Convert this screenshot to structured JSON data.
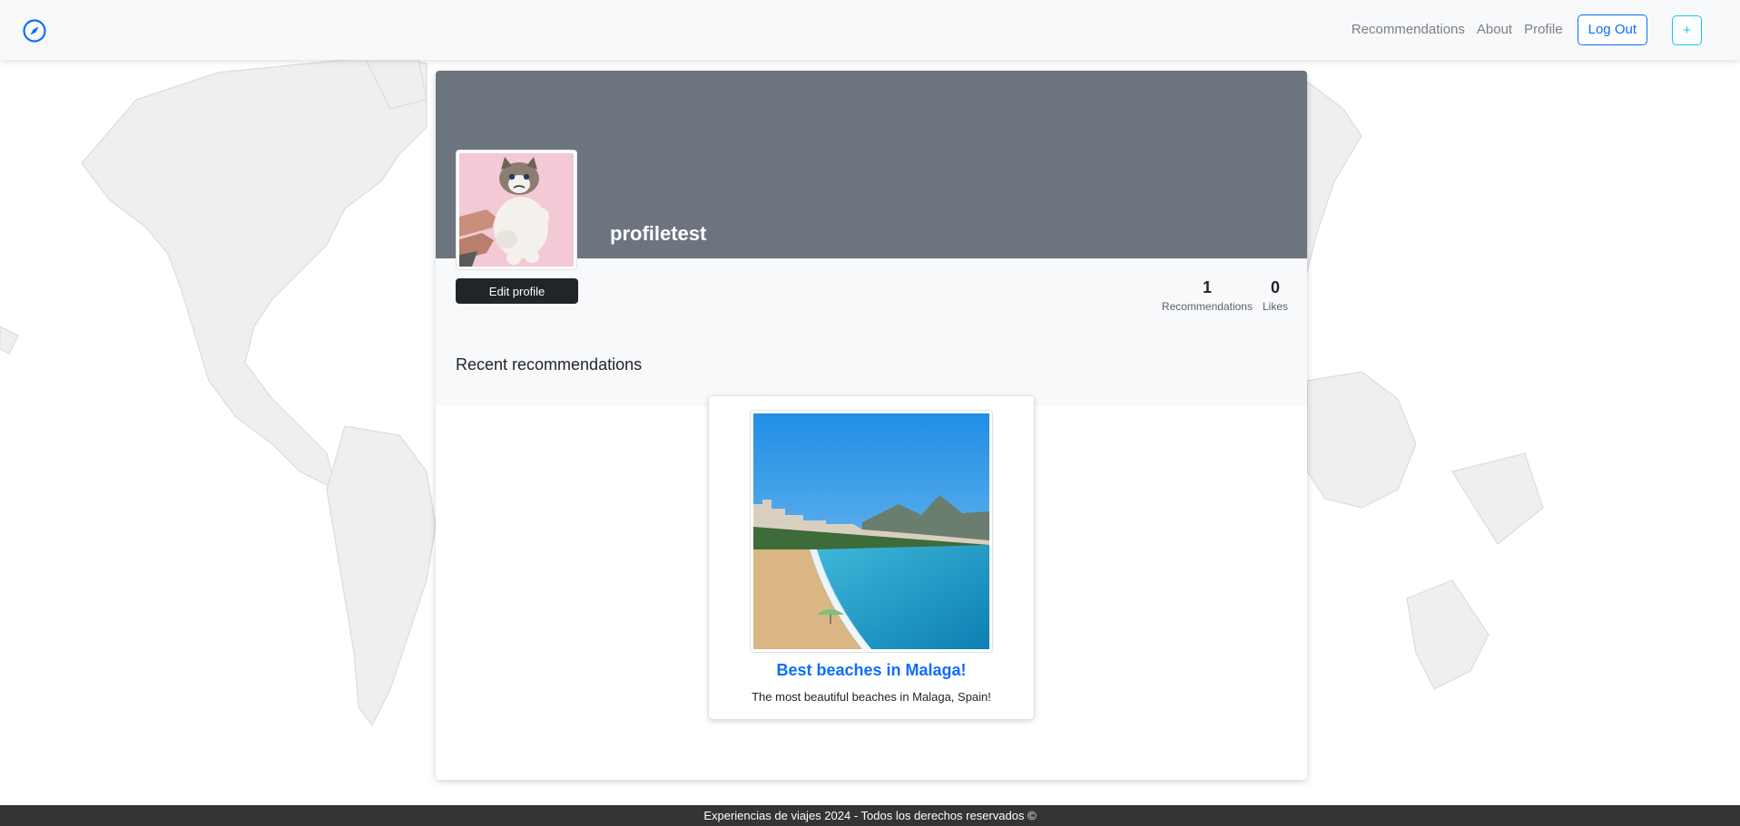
{
  "navbar": {
    "brand_icon": "compass-icon",
    "links": [
      "Recommendations",
      "About",
      "Profile"
    ],
    "logout_label": "Log Out",
    "add_label": "+"
  },
  "profile": {
    "username": "profiletest",
    "edit_label": "Edit profile",
    "stats": [
      {
        "value": "1",
        "label": "Recommendations"
      },
      {
        "value": "0",
        "label": "Likes"
      }
    ]
  },
  "recent": {
    "title": "Recent recommendations",
    "items": [
      {
        "title": "Best beaches in Malaga!",
        "description": "The most beautiful beaches in Malaga, Spain!"
      }
    ]
  },
  "footer": {
    "text": "Experiencias de viajes 2024 - Todos los derechos reservados ©"
  },
  "colors": {
    "primary": "#0d6efd",
    "info": "#0dcaf0",
    "cover": "#6c757d",
    "dark": "#212529",
    "footer": "#343434"
  }
}
